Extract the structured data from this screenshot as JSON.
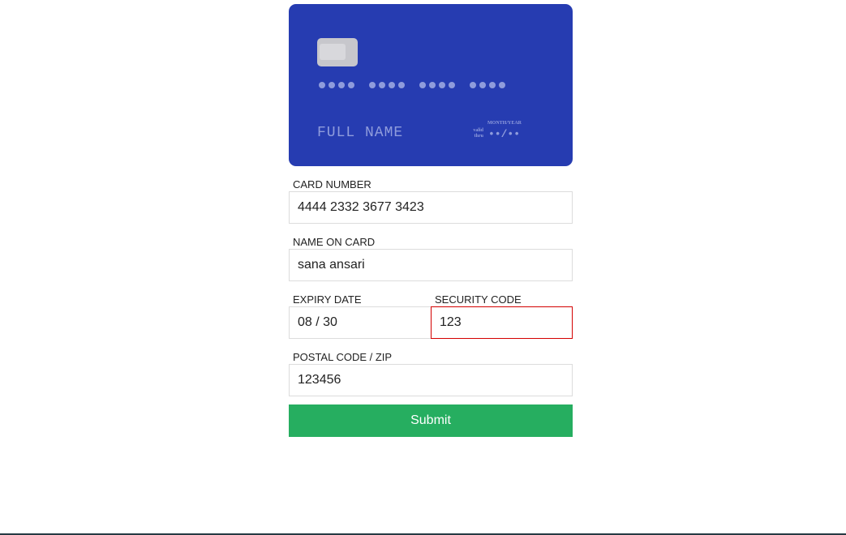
{
  "card_preview": {
    "number_groups": 4,
    "dots_per_group": 4,
    "name_placeholder": "FULL NAME",
    "expiry_caption": "MONTH/YEAR",
    "valid_thru": "valid thru",
    "expiry_placeholder": "••/••"
  },
  "form": {
    "card_number": {
      "label": "CARD NUMBER",
      "value": "4444 2332 3677 3423"
    },
    "name_on_card": {
      "label": "NAME ON CARD",
      "value": "sana ansari"
    },
    "expiry_date": {
      "label": "EXPIRY DATE",
      "value": "08 / 30"
    },
    "security_code": {
      "label": "SECURITY CODE",
      "value": "123",
      "state": "error"
    },
    "postal_code": {
      "label": "POSTAL CODE / ZIP",
      "value": "123456"
    },
    "submit_label": "Submit"
  },
  "colors": {
    "card_bg": "#263cb1",
    "card_text": "#8f9cdc",
    "submit_bg": "#26ae60",
    "error_border": "#d40000"
  }
}
